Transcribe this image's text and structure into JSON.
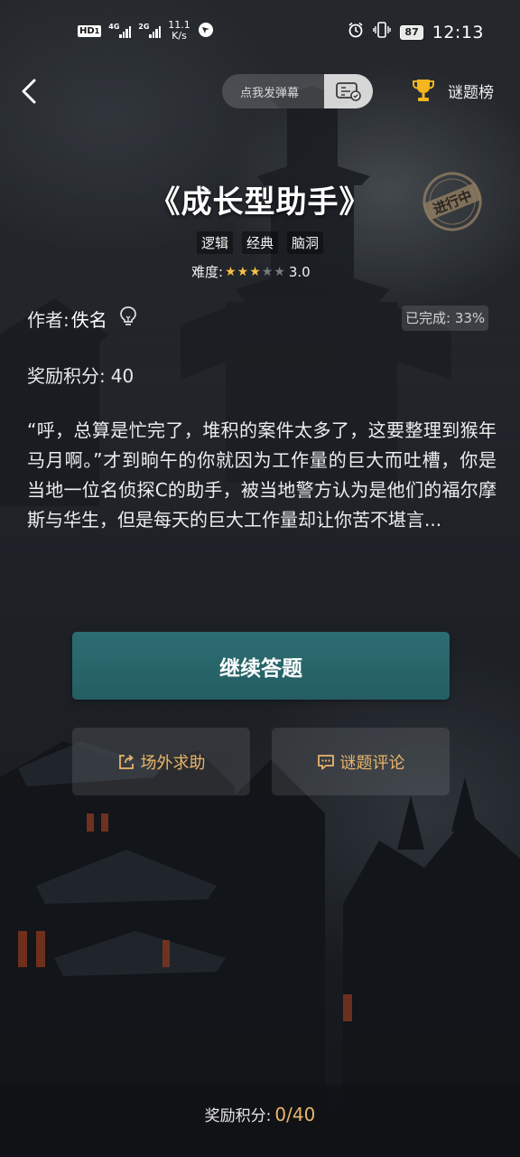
{
  "status_bar": {
    "hd_badge": "HD",
    "hd_sub": "1",
    "signal1_tag": "4G",
    "signal2_tag": "2G",
    "net_speed_value": "11.1",
    "net_speed_unit": "K/s",
    "battery": "87",
    "time": "12:13"
  },
  "nav": {
    "danmaku_placeholder": "点我发弹幕",
    "ranking_label": "谜题榜"
  },
  "puzzle": {
    "title": "《成长型助手",
    "title_close": "》",
    "stamp_text": "进行中",
    "tags": [
      "逻辑",
      "经典",
      "脑洞"
    ],
    "difficulty_label": "难度:",
    "difficulty_rating": 3,
    "difficulty_max": 5,
    "difficulty_value": "3.0",
    "author_label": "作者:",
    "author_name": "佚名",
    "completed": "已完成: 33%",
    "reward_label": "奖励积分:",
    "reward_value": "40",
    "description": "“呼，总算是忙完了，堆积的案件太多了，这要整理到猴年马月啊。”才到晌午的你就因为工作量的巨大而吐槽，你是当地一位名侦探C的助手，被当地警方认为是他们的福尔摩斯与华生，但是每天的巨大工作量却让你苦不堪言..."
  },
  "actions": {
    "continue_label": "继续答题",
    "help_label": "场外求助",
    "comments_label": "谜题评论"
  },
  "footer": {
    "reward_label": "奖励积分:",
    "reward_progress": "0/40"
  },
  "colors": {
    "accent_gold": "#e9b56a",
    "primary_button": "#2c6d71",
    "star_on": "#f6c04a",
    "star_off": "#777b80"
  }
}
